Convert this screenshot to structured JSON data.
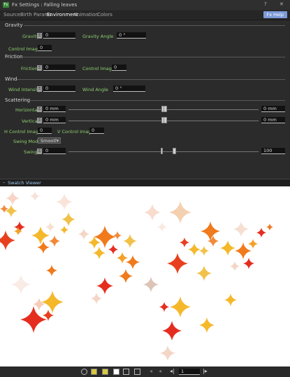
{
  "window": {
    "title": "Fx Settings : Falling leaves",
    "help_label": "?",
    "close_label": "✕"
  },
  "tabs": [
    {
      "label": "Source",
      "active": false
    },
    {
      "label": "Birth Params",
      "active": false
    },
    {
      "label": "Environment",
      "active": true
    },
    {
      "label": "Animation",
      "active": false
    },
    {
      "label": "Colors",
      "active": false
    }
  ],
  "fx_help_label": "Fx Help",
  "gravity": {
    "section": "Gravity",
    "gravity_label": "Gravity",
    "gravity_value": "0",
    "angle_label": "Gravity Angle",
    "angle_value": "0 °",
    "control_image_label": "Control Image",
    "control_image_value": "0"
  },
  "friction": {
    "section": "Friction",
    "friction_label": "Friction",
    "friction_value": "0",
    "control_image_label": "Control Image",
    "control_image_value": "0"
  },
  "wind": {
    "section": "Wind",
    "intensity_label": "Wind Intensity",
    "intensity_value": "0",
    "angle_label": "Wind Angle",
    "angle_value": "0 °"
  },
  "scattering": {
    "section": "Scattering",
    "horizontal_label": "Horizontal",
    "horizontal_value": "0 mm",
    "horizontal_max": "0 mm",
    "vertical_label": "Vertical",
    "vertical_value": "0 mm",
    "vertical_max": "0 mm",
    "h_control_label": "H Control Image",
    "h_control_value": "0",
    "v_control_label": "V Control Image",
    "v_control_value": "0",
    "swing_mode_label": "Swing Mode",
    "swing_mode_value": "Smooth",
    "swing_label": "Swing",
    "swing_value": "0",
    "swing_max": "100"
  },
  "swatch_viewer_label": "Swatch Viewer",
  "frame_field_value": "1",
  "key_icon_glyph": "⚿",
  "colors": {
    "accent_label": "#8fd06f",
    "fx_help": "#7d9bd9",
    "red": "#e52d1f",
    "orange": "#f07a1c",
    "yellow": "#f5b82a",
    "pale": "#f4d6c6"
  }
}
